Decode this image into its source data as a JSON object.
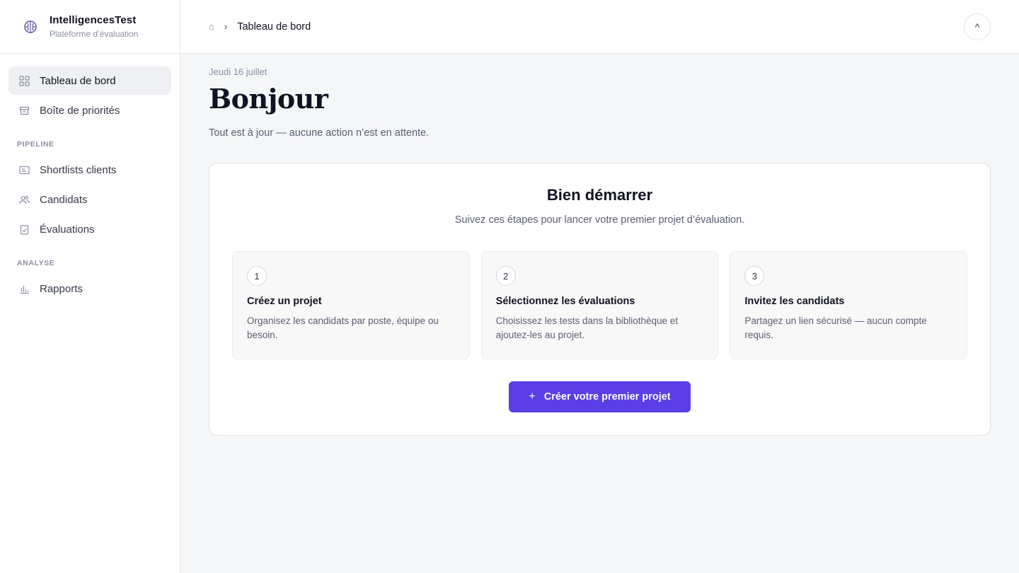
{
  "brand": {
    "name": "IntelligencesTest",
    "subtitle": "Plateforme d’évaluation"
  },
  "sidebar": {
    "primary": [
      {
        "label": "Tableau de bord",
        "icon": "grid-icon",
        "active": true
      },
      {
        "label": "Boîte de priorités",
        "icon": "inbox-icon",
        "active": false
      }
    ],
    "sections": [
      {
        "title": "PIPELINE",
        "items": [
          {
            "label": "Shortlists clients",
            "icon": "list-card-icon"
          },
          {
            "label": "Candidats",
            "icon": "users-icon"
          },
          {
            "label": "Évaluations",
            "icon": "clipboard-check-icon"
          }
        ]
      },
      {
        "title": "ANALYSE",
        "items": [
          {
            "label": "Rapports",
            "icon": "bar-chart-icon"
          }
        ]
      }
    ]
  },
  "header": {
    "home_icon": "⌂",
    "separator": "›",
    "current": "Tableau de bord",
    "collapse_icon": "^"
  },
  "main": {
    "date": "Jeudi 16 juillet",
    "greeting": "Bonjour",
    "status": "Tout est à jour — aucune action n’est en attente."
  },
  "onboarding": {
    "title": "Bien démarrer",
    "subtitle": "Suivez ces étapes pour lancer votre premier projet d’évaluation.",
    "steps": [
      {
        "number": "1",
        "title": "Créez un projet",
        "description": "Organisez les candidats par poste, équipe ou besoin."
      },
      {
        "number": "2",
        "title": "Sélectionnez les évaluations",
        "description": "Choisissez les tests dans la bibliothèque et ajoutez-les au projet."
      },
      {
        "number": "3",
        "title": "Invitez les candidats",
        "description": "Partagez un lien sécurisé — aucun compte requis."
      }
    ],
    "cta_icon": "+",
    "cta_label": "Créer votre premier projet"
  },
  "colors": {
    "accent": "#5b3ee6",
    "brand_logo": "#4c3d8f"
  }
}
